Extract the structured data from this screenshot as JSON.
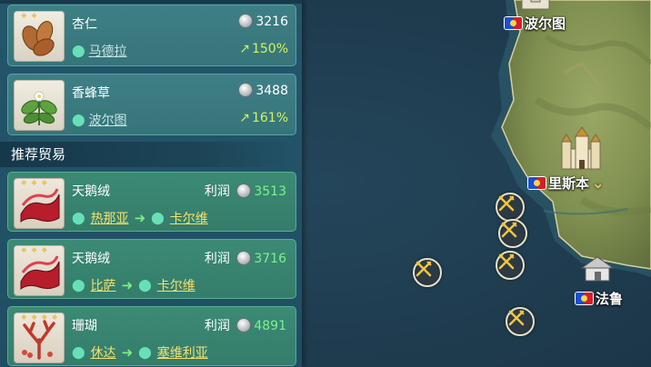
{
  "goods": [
    {
      "name": "杏仁",
      "price": "3216",
      "location": "马德拉",
      "trend": "150%"
    },
    {
      "name": "香蜂草",
      "price": "3488",
      "location": "波尔图",
      "trend": "161%"
    }
  ],
  "section_title": "推荐贸易",
  "profit_label": "利润",
  "trades": [
    {
      "name": "天鹅绒",
      "profit": "3513",
      "from": "热那亚",
      "to": "卡尔维"
    },
    {
      "name": "天鹅绒",
      "profit": "3716",
      "from": "比萨",
      "to": "卡尔维"
    },
    {
      "name": "珊瑚",
      "profit": "4891",
      "from": "休达",
      "to": "塞维利亚"
    }
  ],
  "map": {
    "cities": [
      {
        "name": "波尔图"
      },
      {
        "name": "里斯本"
      },
      {
        "name": "法鲁"
      }
    ]
  },
  "colors": {
    "panel_bg": "#24566b",
    "card_bg": "#3e7f86",
    "trade_card_bg": "#3c8a76",
    "profit_green": "#7cf28c",
    "trend_yellow": "#d6f35a",
    "sea": "#1f3a4d",
    "land": "#8a9a55"
  },
  "icons": [
    "coin-icon",
    "location-pin-icon",
    "trend-up-icon",
    "arrow-right-icon",
    "crossed-swords-icon",
    "flag-icon",
    "castle-icon"
  ]
}
